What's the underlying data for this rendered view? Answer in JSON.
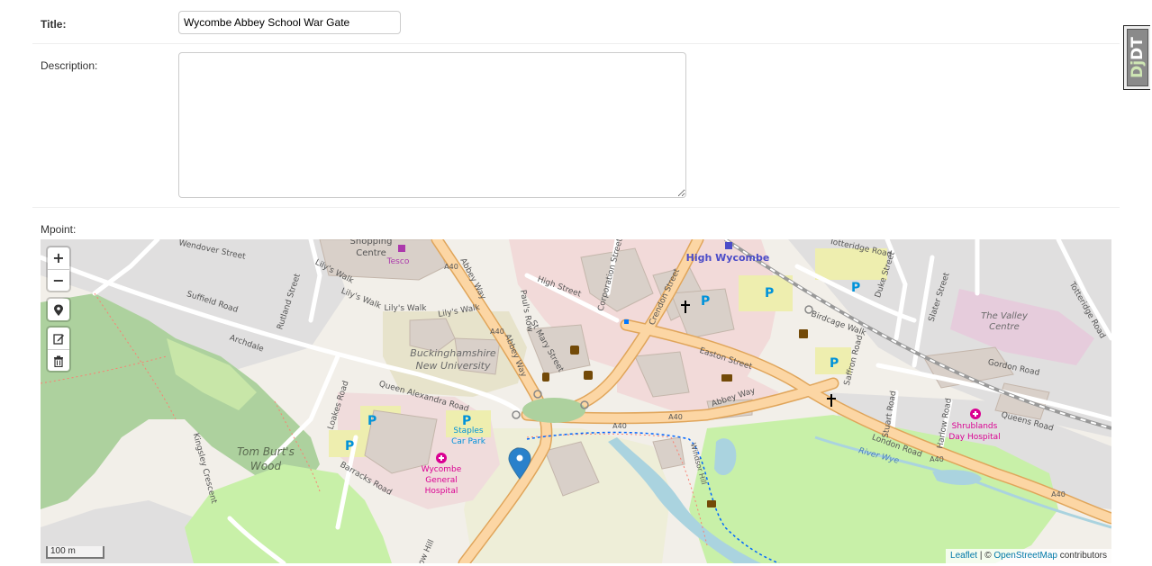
{
  "form": {
    "title_label": "Title:",
    "title_value": "Wycombe Abbey School War Gate",
    "description_label": "Description:",
    "description_value": "",
    "mpoint_label": "Mpoint:"
  },
  "debug_toolbar": {
    "handle_text": "DjDT"
  },
  "map": {
    "controls": {
      "zoom_in": "+",
      "zoom_out": "−"
    },
    "scale_label": "100 m",
    "attribution": {
      "leaflet": "Leaflet",
      "separator": " | © ",
      "osm": "OpenStreetMap",
      "suffix": " contributors"
    },
    "labels": {
      "shopping_1": "Shopping",
      "shopping_2": "Centre",
      "tesco": "Tesco",
      "high_wycombe": "High Wycombe",
      "wendover_street": "Wendover Street",
      "suffield_road": "Suffield Road",
      "rutland_street": "Rutland Street",
      "archdale": "Archdale",
      "lilys_walk_1": "Lily's Walk",
      "lilys_walk_2": "Lily's Walk",
      "lilys_walk_3": "Lily's Walk",
      "lilys_walk_4": "Lily's Walk",
      "abbey_way_1": "Abbey Way",
      "abbey_way_2": "Abbey Way",
      "abbey_way_3": "Abbey Way",
      "a40_1": "A40",
      "a40_2": "A40",
      "a40_3": "A40",
      "a40_4": "A40",
      "a40_5": "A40",
      "a40_6": "A40",
      "buckinghamshire_1": "Buckinghamshire",
      "buckinghamshire_2": "New University",
      "queen_alexandra_road": "Queen Alexandra Road",
      "loakes_road": "Loakes Road",
      "tom_burts_1": "Tom Burt's",
      "tom_burts_2": "Wood",
      "barracks_road": "Barracks Road",
      "kingsley_crescent": "Kingsley Crescent",
      "staples_1": "Staples",
      "staples_2": "Car Park",
      "wycombe_general_1": "Wycombe",
      "wycombe_general_2": "General",
      "wycombe_general_3": "Hospital",
      "high_street": "High Street",
      "corporation_street": "Corporation Street",
      "crendon_street": "Crendon Street",
      "easton_street": "Easton Street",
      "st_mary_street": "St Mary Street",
      "pauls_row": "Paul's Row",
      "totteridge_road_1": "Totteridge Road",
      "totteridge_road_2": "Totteridge Road",
      "duke_street": "Duke Street",
      "slater_street": "Slater Street",
      "the_valley_1": "The Valley",
      "the_valley_2": "Centre",
      "birdcage_walk": "Birdcage Walk",
      "saffron_road": "Saffron Road",
      "gordon_road": "Gordon Road",
      "stuart_road": "Stuart Road",
      "harlow_road": "Harlow Road",
      "queens_road": "Queens Road",
      "shrublands_1": "Shrublands",
      "shrublands_2": "Day Hospital",
      "london_road": "London Road",
      "river_wye": "River Wye",
      "windsor_hill": "Windsor Hill",
      "amersham_hill": "low Hill"
    }
  },
  "colors": {
    "road_major": "#f8c982",
    "road_major_casing": "#e0a55a",
    "park": "#c8e6a8",
    "wood": "#9ccb86",
    "building": "#d9d0c9",
    "retail": "#f2dad9",
    "parking": "#eeeeaf",
    "hospital": "#e2a5c8",
    "water": "#aad3df",
    "marker": "#2a81cb",
    "parking_label": "#0092da",
    "hospital_label": "#da0092"
  }
}
